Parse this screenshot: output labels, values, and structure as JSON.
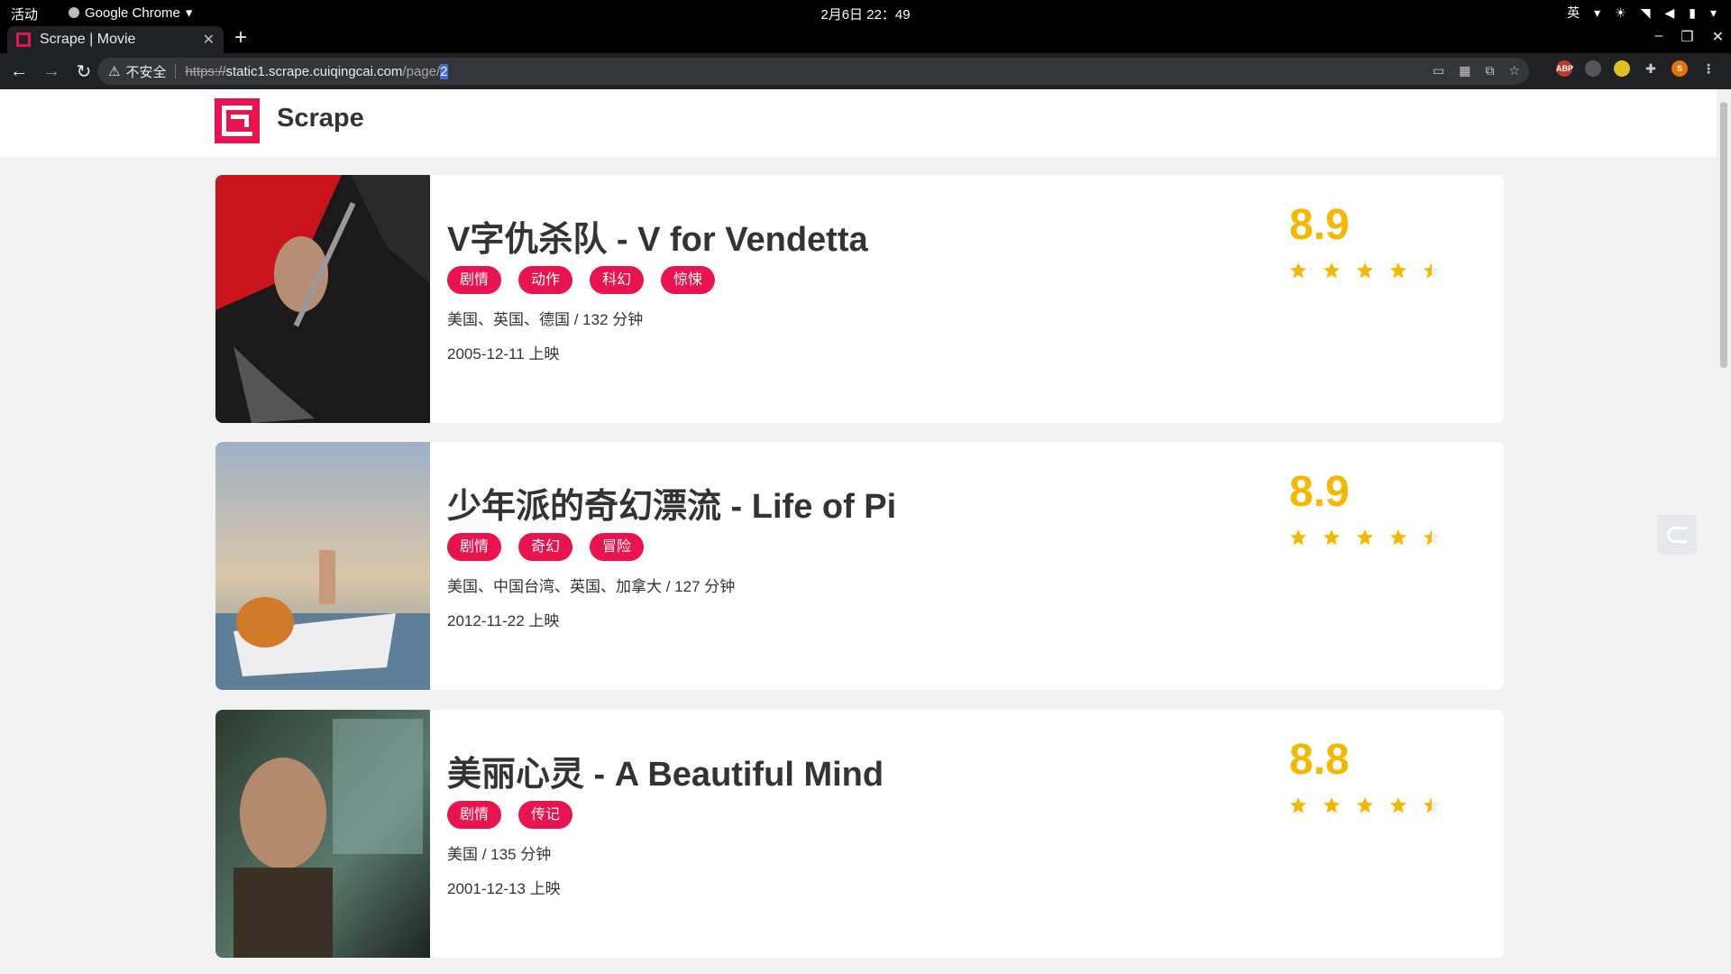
{
  "os": {
    "activities": "活动",
    "app_name": "Google Chrome",
    "clock": "2月6日 22：49",
    "input_method": "英"
  },
  "browser": {
    "tab_title": "Scrape | Movie",
    "insecure_label": "不安全",
    "url_scheme": "https://",
    "url_host": "static1.scrape.cuiqingcai.com",
    "url_path": "/page/",
    "url_selected": "2",
    "profile_initial": "S",
    "abp_label": "ABP"
  },
  "site": {
    "brand": "Scrape"
  },
  "colors": {
    "accent": "#e8134f",
    "score": "#f6b700"
  },
  "movies": [
    {
      "title": "V字仇杀队 - V for Vendetta",
      "tags": [
        "剧情",
        "动作",
        "科幻",
        "惊悚"
      ],
      "meta": "美国、英国、德国 / 132 分钟",
      "date": "2005-12-11 上映",
      "score": "8.9",
      "rating_stars": 4.5
    },
    {
      "title": "少年派的奇幻漂流 - Life of Pi",
      "tags": [
        "剧情",
        "奇幻",
        "冒险"
      ],
      "meta": "美国、中国台湾、英国、加拿大 / 127 分钟",
      "date": "2012-11-22 上映",
      "score": "8.9",
      "rating_stars": 4.5
    },
    {
      "title": "美丽心灵 - A Beautiful Mind",
      "tags": [
        "剧情",
        "传记"
      ],
      "meta": "美国 / 135 分钟",
      "date": "2001-12-13 上映",
      "score": "8.8",
      "rating_stars": 4.5
    }
  ]
}
